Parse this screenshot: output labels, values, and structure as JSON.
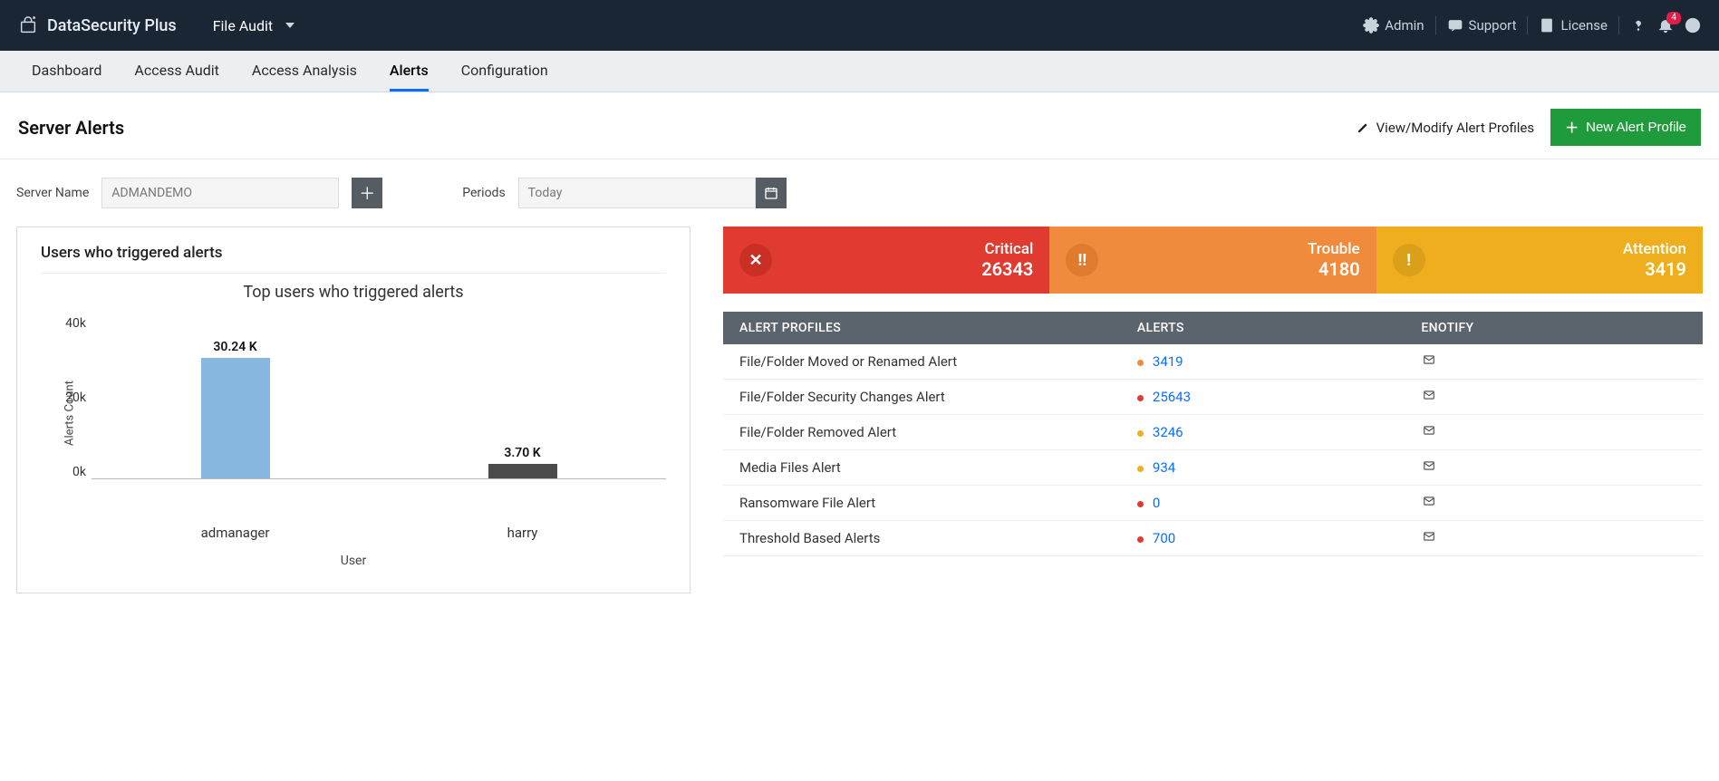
{
  "header": {
    "app_name": "DataSecurity Plus",
    "module": "File Audit",
    "links": {
      "admin": "Admin",
      "support": "Support",
      "license": "License"
    },
    "notif_count": "4"
  },
  "nav": {
    "tabs": [
      "Dashboard",
      "Access Audit",
      "Access Analysis",
      "Alerts",
      "Configuration"
    ],
    "active": "Alerts"
  },
  "page": {
    "title": "Server Alerts",
    "view_modify": "View/Modify Alert Profiles",
    "new_profile": "New Alert Profile"
  },
  "filters": {
    "server_label": "Server Name",
    "server_value": "ADMANDEMO",
    "period_label": "Periods",
    "period_value": "Today"
  },
  "chart_card": {
    "title": "Users who triggered alerts"
  },
  "chart_data": {
    "type": "bar",
    "title": "Top users who triggered alerts",
    "xlabel": "User",
    "ylabel": "Alerts Count",
    "ylim": [
      0,
      40000
    ],
    "yticks": [
      "40k",
      "20k",
      "0k"
    ],
    "categories": [
      "admanager",
      "harry"
    ],
    "values": [
      30240,
      3700
    ],
    "value_labels": [
      "30.24 K",
      "3.70 K"
    ]
  },
  "severity": {
    "critical": {
      "label": "Critical",
      "count": "26343"
    },
    "trouble": {
      "label": "Trouble",
      "count": "4180"
    },
    "attention": {
      "label": "Attention",
      "count": "3419"
    }
  },
  "profile_table": {
    "cols": {
      "name": "ALERT PROFILES",
      "alerts": "ALERTS",
      "notify": "ENOTIFY"
    },
    "rows": [
      {
        "name": "File/Folder Moved or Renamed Alert",
        "sev": "orange",
        "count": "3419"
      },
      {
        "name": "File/Folder Security Changes Alert",
        "sev": "red",
        "count": "25643"
      },
      {
        "name": "File/Folder Removed Alert",
        "sev": "yellow",
        "count": "3246"
      },
      {
        "name": "Media Files Alert",
        "sev": "yellow",
        "count": "934"
      },
      {
        "name": "Ransomware File Alert",
        "sev": "red",
        "count": "0"
      },
      {
        "name": "Threshold Based Alerts",
        "sev": "red",
        "count": "700"
      }
    ]
  }
}
